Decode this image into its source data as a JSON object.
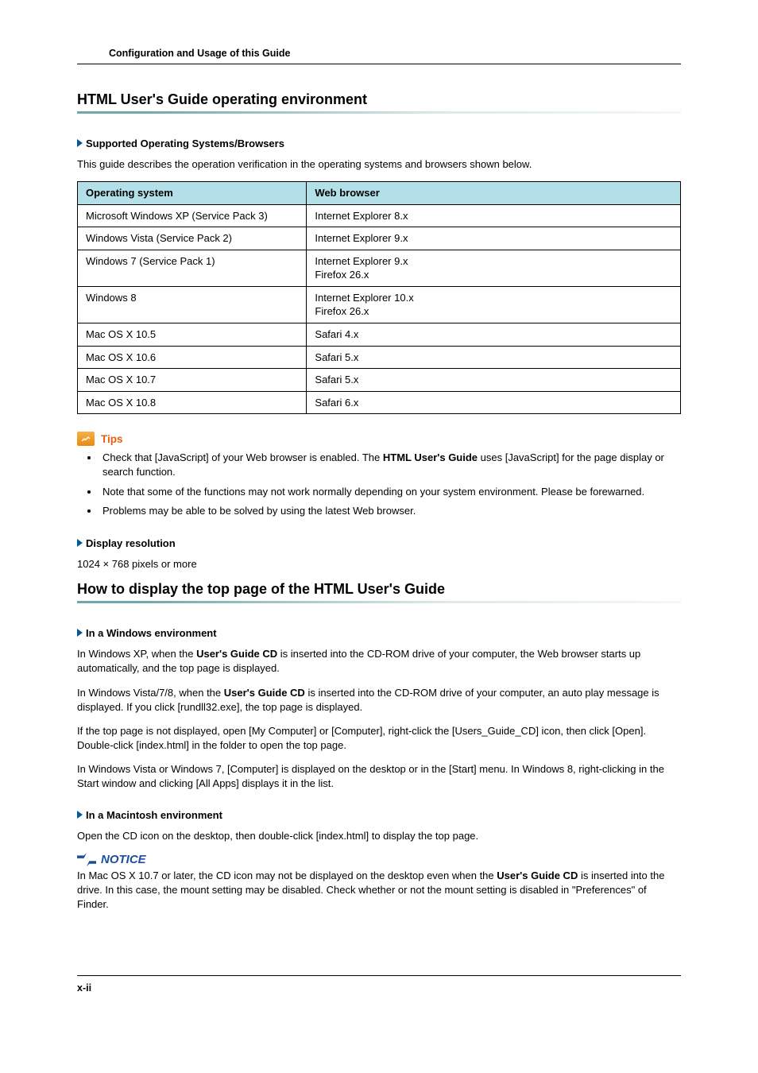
{
  "header": {
    "running_title": "Configuration and Usage of this Guide"
  },
  "section1": {
    "title": "HTML User's Guide operating environment",
    "sub1": {
      "heading": "Supported Operating Systems/Browsers",
      "intro": "This guide describes the operation verification in the operating systems and browsers shown below."
    },
    "table": {
      "head_os": "Operating system",
      "head_browser": "Web browser",
      "rows": [
        {
          "os": "Microsoft Windows XP (Service Pack 3)",
          "browser": "Internet Explorer 8.x"
        },
        {
          "os": "Windows Vista (Service Pack 2)",
          "browser": "Internet Explorer 9.x"
        },
        {
          "os": "Windows 7 (Service Pack 1)",
          "browser": "Internet Explorer 9.x\nFirefox 26.x"
        },
        {
          "os": "Windows 8",
          "browser": "Internet Explorer 10.x\nFirefox 26.x"
        },
        {
          "os": "Mac OS X 10.5",
          "browser": "Safari 4.x"
        },
        {
          "os": "Mac OS X 10.6",
          "browser": "Safari 5.x"
        },
        {
          "os": "Mac OS X 10.7",
          "browser": "Safari 5.x"
        },
        {
          "os": "Mac OS X 10.8",
          "browser": "Safari 6.x"
        }
      ]
    },
    "tips": {
      "label": "Tips",
      "items": [
        {
          "pre": "Check that [JavaScript] of your Web browser is enabled. The ",
          "bold": "HTML User's Guide",
          "post": " uses [JavaScript] for the page display or search function."
        },
        {
          "pre": "Note that some of the functions may not work normally depending on your system environment. Please be forewarned.",
          "bold": "",
          "post": ""
        },
        {
          "pre": "Problems may be able to be solved by using the latest Web browser.",
          "bold": "",
          "post": ""
        }
      ]
    },
    "sub2": {
      "heading": "Display resolution",
      "body": "1024 × 768 pixels or more"
    }
  },
  "section2": {
    "title": "How to display the top page of the HTML User's Guide",
    "win": {
      "heading": "In a Windows environment",
      "p1_pre": "In Windows XP, when the ",
      "p1_bold": "User's Guide CD",
      "p1_post": " is inserted into the CD-ROM drive of your computer, the Web browser starts up automatically, and the top page is displayed.",
      "p2_pre": "In Windows Vista/7/8, when the ",
      "p2_bold": "User's Guide CD",
      "p2_post": " is inserted into the CD-ROM drive of your computer, an auto play message is displayed. If you click [rundll32.exe], the top page is displayed.",
      "p3": "If the top page is not displayed, open [My Computer] or [Computer], right-click the [Users_Guide_CD] icon, then click [Open]. Double-click [index.html] in the folder to open the top page.",
      "p4": "In Windows Vista or Windows 7, [Computer] is displayed on the desktop or in the [Start] menu. In Windows 8, right-clicking in the Start window and clicking [All Apps] displays it in the list."
    },
    "mac": {
      "heading": "In a Macintosh environment",
      "p1": "Open the CD icon on the desktop, then double-click [index.html] to display the top page."
    },
    "notice": {
      "label": "NOTICE",
      "body_pre": "In Mac OS X 10.7 or later, the CD icon may not be displayed on the desktop even when the ",
      "body_bold": "User's Guide CD",
      "body_post": " is inserted into the drive. In this case, the mount setting may be disabled. Check whether or not the mount setting is disabled in \"Preferences\" of Finder."
    }
  },
  "footer": {
    "page": "x-ii"
  }
}
